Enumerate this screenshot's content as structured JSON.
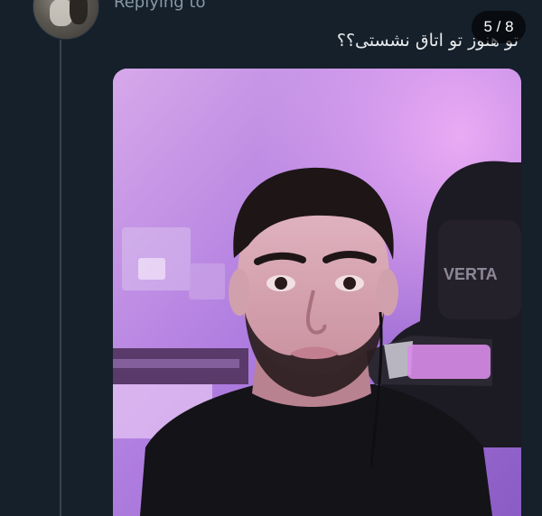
{
  "header": {
    "replying_label": "Replying to"
  },
  "tweet": {
    "text": "تو هنوز تو اتاق نشستی؟؟"
  },
  "media": {
    "counter": "5 / 8",
    "chair_brand": "VERTA"
  },
  "colors": {
    "background": "#15202b",
    "thread_line": "#38444d",
    "muted_text": "#8899a6",
    "photo_purple": "#b77fe0"
  }
}
